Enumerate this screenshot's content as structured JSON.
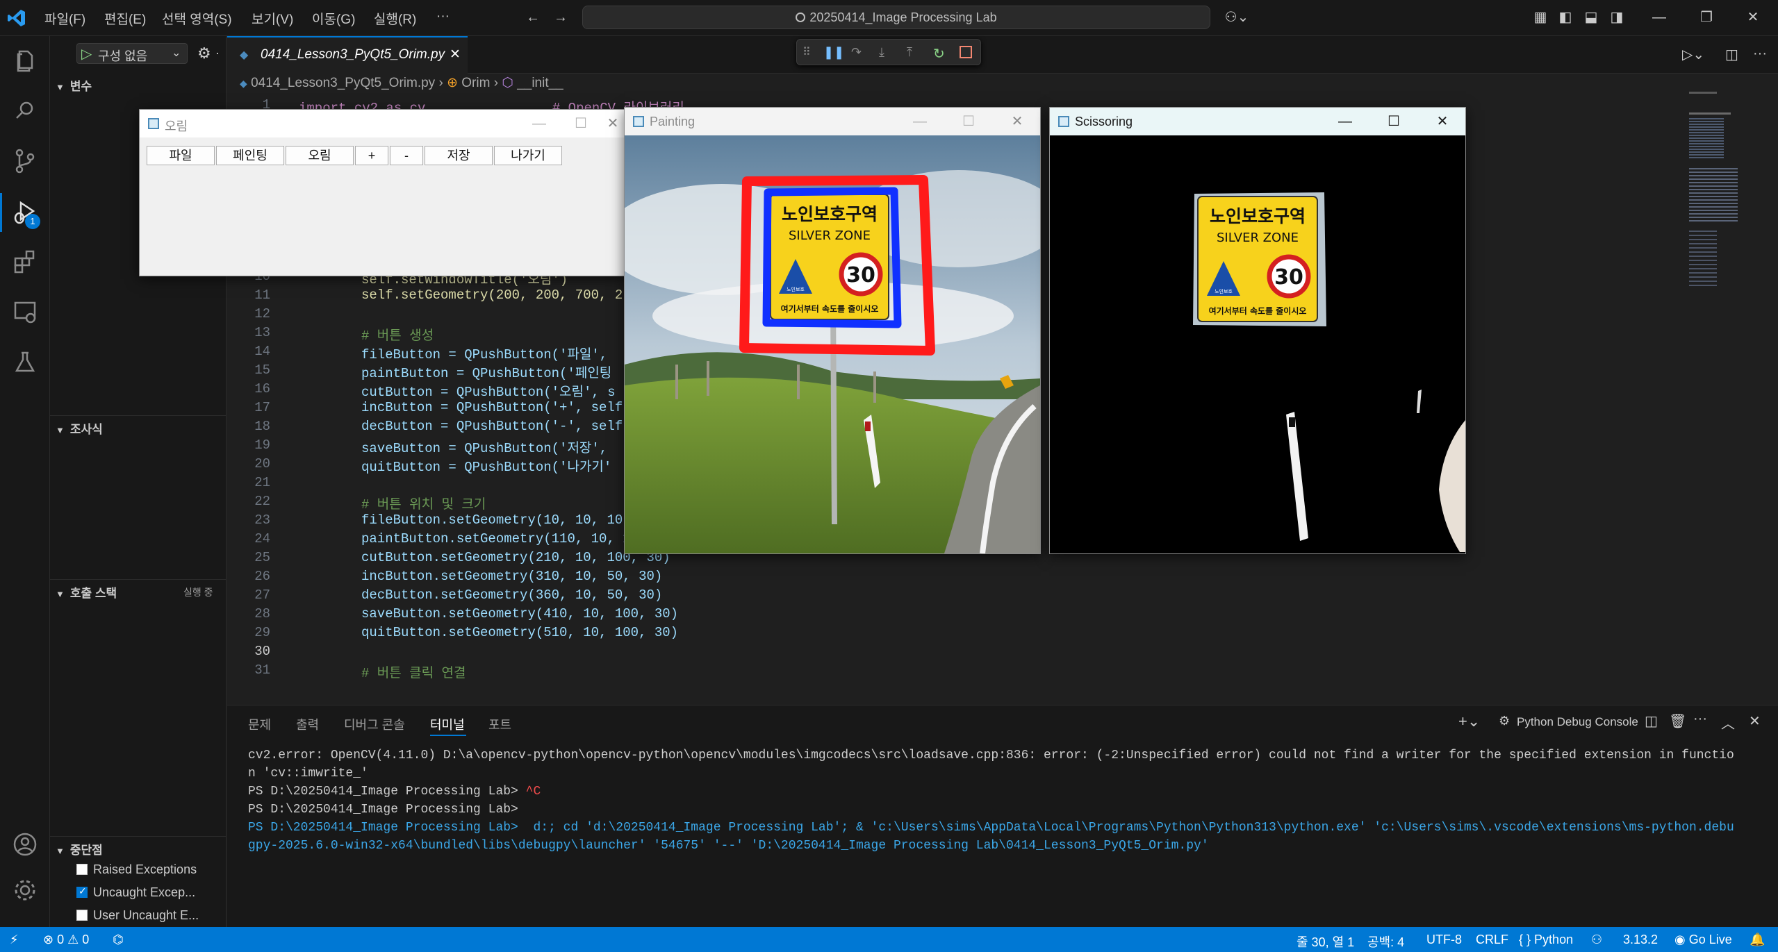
{
  "titlebar": {
    "menus": [
      "파일(F)",
      "편집(E)",
      "선택 영역(S)",
      "보기(V)",
      "이동(G)",
      "실행(R)",
      "···"
    ],
    "search_text": "20250414_Image Processing Lab"
  },
  "sidebar": {
    "run_config": "구성 없음",
    "variables_title": "변수",
    "watch_title": "조사식",
    "callstack_title": "호출 스택",
    "callstack_status": "실행 중",
    "breakpoints_title": "중단점",
    "breakpoints": [
      {
        "label": "Raised Exceptions",
        "checked": false
      },
      {
        "label": "Uncaught Excep...",
        "checked": true
      },
      {
        "label": "User Uncaught E...",
        "checked": false
      }
    ],
    "debug_badge": "1"
  },
  "editor": {
    "tab_title": "0414_Lesson3_PyQt5_Orim.py",
    "breadcrumb": {
      "file": "0414_Lesson3_PyQt5_Orim.py",
      "class": "Orim",
      "method": "__init__"
    },
    "lines": [
      {
        "n": "1",
        "text": "import cv2 as cv                # OpenCV 라이브러리"
      },
      {
        "n": "10",
        "text": "self.setWindowTitle('오림')"
      },
      {
        "n": "11",
        "text": "self.setGeometry(200, 200, 700, 2"
      },
      {
        "n": "12",
        "text": ""
      },
      {
        "n": "13",
        "text": "# 버튼 생성"
      },
      {
        "n": "14",
        "text": "fileButton = QPushButton('파일', "
      },
      {
        "n": "15",
        "text": "paintButton = QPushButton('페인팅"
      },
      {
        "n": "16",
        "text": "cutButton = QPushButton('오림', s"
      },
      {
        "n": "17",
        "text": "incButton = QPushButton('+', self"
      },
      {
        "n": "18",
        "text": "decButton = QPushButton('-', self"
      },
      {
        "n": "19",
        "text": "saveButton = QPushButton('저장', "
      },
      {
        "n": "20",
        "text": "quitButton = QPushButton('나가기'"
      },
      {
        "n": "21",
        "text": ""
      },
      {
        "n": "22",
        "text": "# 버튼 위치 및 크기"
      },
      {
        "n": "23",
        "text": "fileButton.setGeometry(10, 10, 10"
      },
      {
        "n": "24",
        "text": "paintButton.setGeometry(110, 10, 100, 30)"
      },
      {
        "n": "25",
        "text": "cutButton.setGeometry(210, 10, 100, 30)"
      },
      {
        "n": "26",
        "text": "incButton.setGeometry(310, 10, 50, 30)"
      },
      {
        "n": "27",
        "text": "decButton.setGeometry(360, 10, 50, 30)"
      },
      {
        "n": "28",
        "text": "saveButton.setGeometry(410, 10, 100, 30)"
      },
      {
        "n": "29",
        "text": "quitButton.setGeometry(510, 10, 100, 30)"
      },
      {
        "n": "30",
        "text": ""
      },
      {
        "n": "31",
        "text": "# 버튼 클릭 연결"
      }
    ]
  },
  "panel": {
    "tabs": [
      "문제",
      "출력",
      "디버그 콘솔",
      "터미널",
      "포트"
    ],
    "active_tab": "터미널",
    "console_label": "Python Debug Console",
    "terminal_lines": [
      "cv2.error: OpenCV(4.11.0) D:\\a\\opencv-python\\opencv-python\\opencv\\modules\\imgcodecs\\src\\loadsave.cpp:836: error: (-2:Unspecified error) could not find a writer for the specified extension in functio",
      "n 'cv::imwrite_'",
      "PS D:\\20250414_Image Processing Lab> ^C",
      "PS D:\\20250414_Image Processing Lab>",
      "PS D:\\20250414_Image Processing Lab>  d:; cd 'd:\\20250414_Image Processing Lab'; & 'c:\\Users\\sims\\AppData\\Local\\Programs\\Python\\Python313\\python.exe' 'c:\\Users\\sims\\.vscode\\extensions\\ms-python.debu",
      "gpy-2025.6.0-win32-x64\\bundled\\libs\\debugpy\\launcher' '54675' '--' 'D:\\20250414_Image Processing Lab\\0414_Lesson3_PyQt5_Orim.py'"
    ]
  },
  "statusbar": {
    "errors": "0",
    "warnings": "0",
    "position": "줄 30, 열 1",
    "spaces": "공백: 4",
    "encoding": "UTF-8",
    "eol": "CRLF",
    "language": "Python",
    "version": "3.13.2",
    "golive": "Go Live"
  },
  "qt_windows": {
    "orim": {
      "title": "오림",
      "buttons": [
        "파일",
        "페인팅",
        "오림",
        "+",
        "-",
        "저장",
        "나가기"
      ]
    },
    "painting": {
      "title": "Painting"
    },
    "scissoring": {
      "title": "Scissoring"
    }
  },
  "sign": {
    "line1": "노인보호구역",
    "line2": "SILVER ZONE",
    "speed": "30",
    "small": "노인보호",
    "bottom": "여기서부터 속도를 줄이시오"
  },
  "colors": {
    "accent": "#0078d4",
    "paint_red": "#ff1a1a",
    "paint_blue": "#1030ff",
    "sign_yellow": "#f7d21c"
  }
}
